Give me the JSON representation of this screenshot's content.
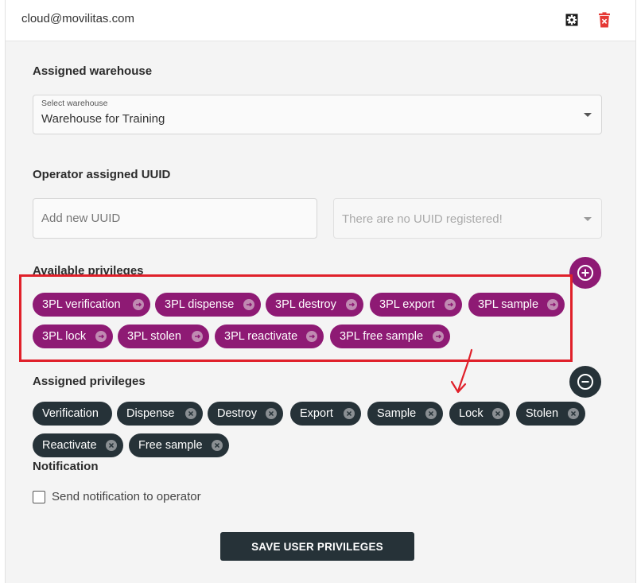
{
  "header": {
    "user_email": "cloud@movilitas.com",
    "settings_icon": "gear-icon",
    "delete_icon": "trash-icon",
    "delete_color": "#e53935"
  },
  "warehouse": {
    "title": "Assigned warehouse",
    "select_label": "Select warehouse",
    "selected": "Warehouse for Training"
  },
  "uuid": {
    "title": "Operator assigned UUID",
    "input_placeholder": "Add new UUID",
    "input_value": "",
    "select_placeholder": "There are no UUID registered!"
  },
  "available_privileges": {
    "title": "Available privileges",
    "chip_color": "#8e1a74",
    "items": [
      {
        "label": "3PL verification"
      },
      {
        "label": "3PL dispense"
      },
      {
        "label": "3PL destroy"
      },
      {
        "label": "3PL export"
      },
      {
        "label": "3PL sample"
      },
      {
        "label": "3PL lock"
      },
      {
        "label": "3PL stolen"
      },
      {
        "label": "3PL reactivate"
      },
      {
        "label": "3PL free sample"
      }
    ],
    "add_icon": "plus-circle-icon"
  },
  "assigned_privileges": {
    "title": "Assigned privileges",
    "chip_color": "#263238",
    "items": [
      {
        "label": "Verification"
      },
      {
        "label": "Dispense"
      },
      {
        "label": "Destroy"
      },
      {
        "label": "Export"
      },
      {
        "label": "Sample"
      },
      {
        "label": "Lock"
      },
      {
        "label": "Stolen"
      },
      {
        "label": "Reactivate"
      },
      {
        "label": "Free sample"
      }
    ],
    "remove_icon": "minus-circle-icon"
  },
  "notification": {
    "title": "Notification",
    "checkbox_label": "Send notification to operator",
    "checked": false
  },
  "actions": {
    "save_label": "SAVE USER PRIVILEGES"
  },
  "annotation": {
    "highlight_color": "#e0202a"
  }
}
